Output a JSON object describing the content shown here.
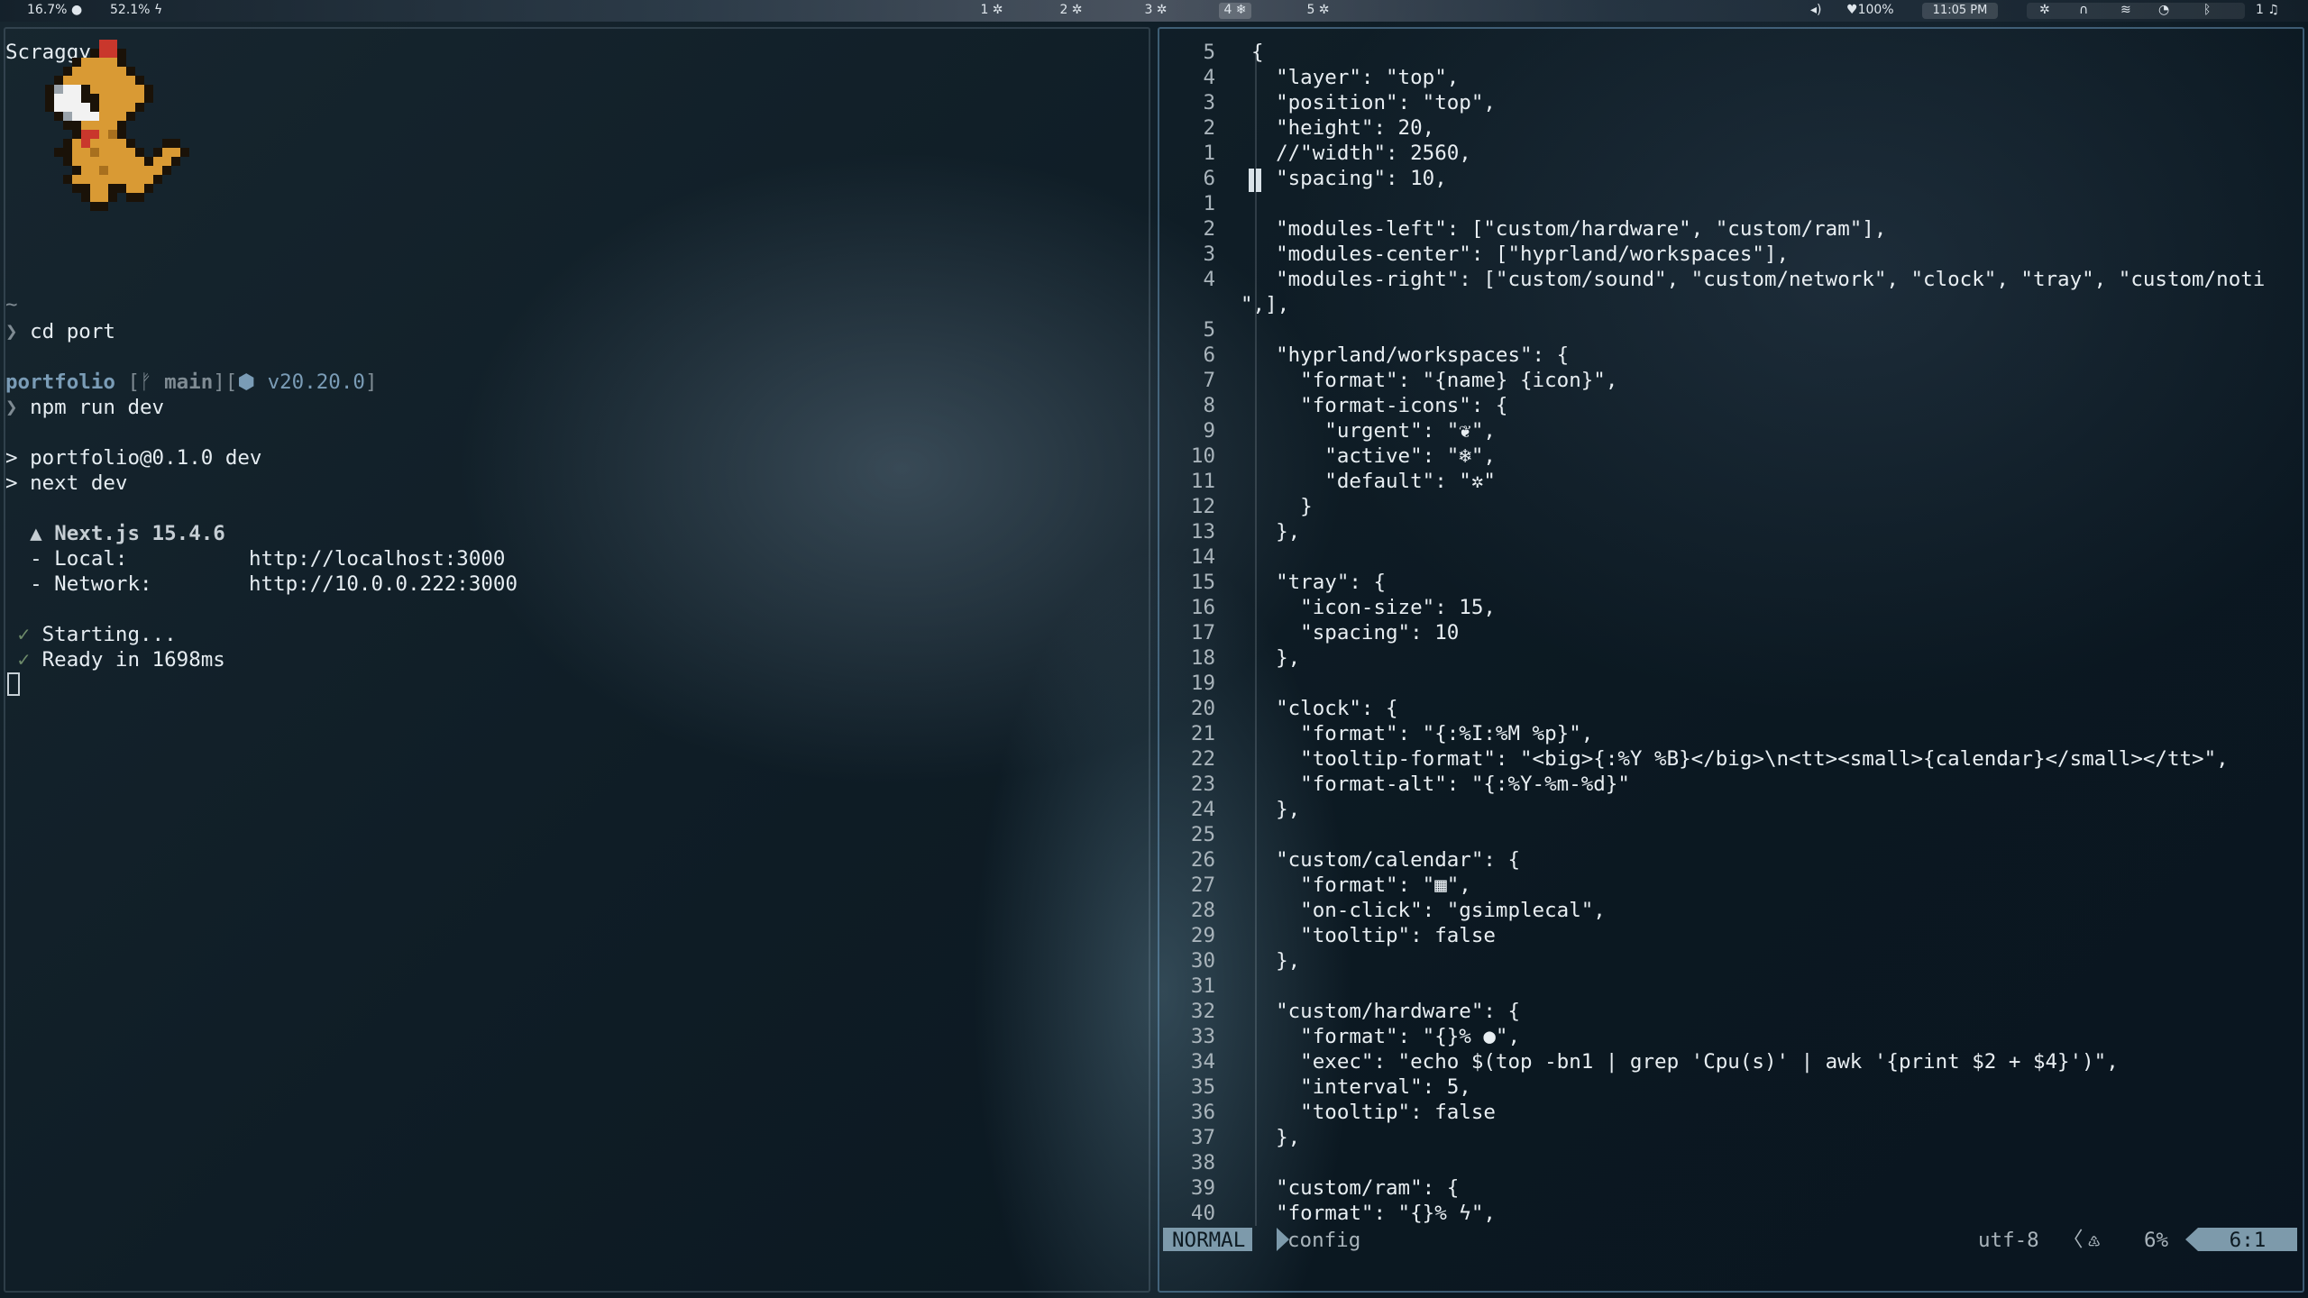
{
  "topbar": {
    "cpu": "16.7%",
    "ram": "52.1%",
    "workspaces": [
      {
        "label": "1 ✲"
      },
      {
        "label": "2 ✲"
      },
      {
        "label": "3 ✲"
      },
      {
        "label": "4 ❄"
      },
      {
        "label": "5 ✲"
      }
    ],
    "active_workspace": "4",
    "volume_icon": "🔈",
    "network": "100%",
    "clock": "11:05 PM",
    "notifications": "1"
  },
  "terminal": {
    "pokemon_name": "Scraggy",
    "home": "~",
    "cmd1": "cd port",
    "dir": "portfolio",
    "branch": "main",
    "node_version": "v20.20.0",
    "cmd2": "npm run dev",
    "out1": "> portfolio@0.1.0 dev",
    "out2": "> next dev",
    "next_banner": "Next.js 15.4.6",
    "local_label": "- Local:",
    "local_url": "http://localhost:3000",
    "network_label": "- Network:",
    "network_url": "http://10.0.0.222:3000",
    "starting": "Starting...",
    "ready": "Ready in 1698ms"
  },
  "editor": {
    "lines": [
      {
        "n": "5",
        "code": "{"
      },
      {
        "n": "4",
        "code": "  \"layer\": \"top\","
      },
      {
        "n": "3",
        "code": "  \"position\": \"top\","
      },
      {
        "n": "2",
        "code": "  \"height\": 20,"
      },
      {
        "n": "1",
        "code": "  //\"width\": 2560,"
      },
      {
        "n": "6",
        "code": "  \"spacing\": 10,"
      },
      {
        "n": "1",
        "code": ""
      },
      {
        "n": "2",
        "code": "  \"modules-left\": [\"custom/hardware\", \"custom/ram\"],"
      },
      {
        "n": "3",
        "code": "  \"modules-center\": [\"hyprland/workspaces\"],"
      },
      {
        "n": "4",
        "code": "  \"modules-right\": [\"custom/sound\", \"custom/network\", \"clock\", \"tray\", \"custom/noti"
      },
      {
        "n": "",
        "code": "\",],"
      },
      {
        "n": "5",
        "code": ""
      },
      {
        "n": "6",
        "code": "  \"hyprland/workspaces\": {"
      },
      {
        "n": "7",
        "code": "    \"format\": \"{name} {icon}\","
      },
      {
        "n": "8",
        "code": "    \"format-icons\": {"
      },
      {
        "n": "9",
        "code": "      \"urgent\": \"❦\","
      },
      {
        "n": "10",
        "code": "      \"active\": \"❄\","
      },
      {
        "n": "11",
        "code": "      \"default\": \"✲\""
      },
      {
        "n": "12",
        "code": "    }"
      },
      {
        "n": "13",
        "code": "  },"
      },
      {
        "n": "14",
        "code": ""
      },
      {
        "n": "15",
        "code": "  \"tray\": {"
      },
      {
        "n": "16",
        "code": "    \"icon-size\": 15,"
      },
      {
        "n": "17",
        "code": "    \"spacing\": 10"
      },
      {
        "n": "18",
        "code": "  },"
      },
      {
        "n": "19",
        "code": ""
      },
      {
        "n": "20",
        "code": "  \"clock\": {"
      },
      {
        "n": "21",
        "code": "    \"format\": \"{:%I:%M %p}\","
      },
      {
        "n": "22",
        "code": "    \"tooltip-format\": \"<big>{:%Y %B}</big>\\n<tt><small>{calendar}</small></tt>\","
      },
      {
        "n": "23",
        "code": "    \"format-alt\": \"{:%Y-%m-%d}\""
      },
      {
        "n": "24",
        "code": "  },"
      },
      {
        "n": "25",
        "code": ""
      },
      {
        "n": "26",
        "code": "  \"custom/calendar\": {"
      },
      {
        "n": "27",
        "code": "    \"format\": \"▦\","
      },
      {
        "n": "28",
        "code": "    \"on-click\": \"gsimplecal\","
      },
      {
        "n": "29",
        "code": "    \"tooltip\": false"
      },
      {
        "n": "30",
        "code": "  },"
      },
      {
        "n": "31",
        "code": ""
      },
      {
        "n": "32",
        "code": "  \"custom/hardware\": {"
      },
      {
        "n": "33",
        "code": "    \"format\": \"{}% ●\","
      },
      {
        "n": "34",
        "code": "    \"exec\": \"echo $(top -bn1 | grep 'Cpu(s)' | awk '{print $2 + $4}')\","
      },
      {
        "n": "35",
        "code": "    \"interval\": 5,"
      },
      {
        "n": "36",
        "code": "    \"tooltip\": false"
      },
      {
        "n": "37",
        "code": "  },"
      },
      {
        "n": "38",
        "code": ""
      },
      {
        "n": "39",
        "code": "  \"custom/ram\": {"
      },
      {
        "n": "40",
        "code": "  \"format\": \"{}% ϟ\","
      }
    ]
  },
  "status": {
    "mode": "NORMAL",
    "filename": "config",
    "encoding": "utf-8",
    "separator": "〈",
    "filetype_icon": "♳",
    "percent": "6%",
    "position": "6:1"
  },
  "colors": {
    "accent": "#7d9aab",
    "prompt_blue": "#7a9cb6",
    "background": "#0f1d26"
  }
}
